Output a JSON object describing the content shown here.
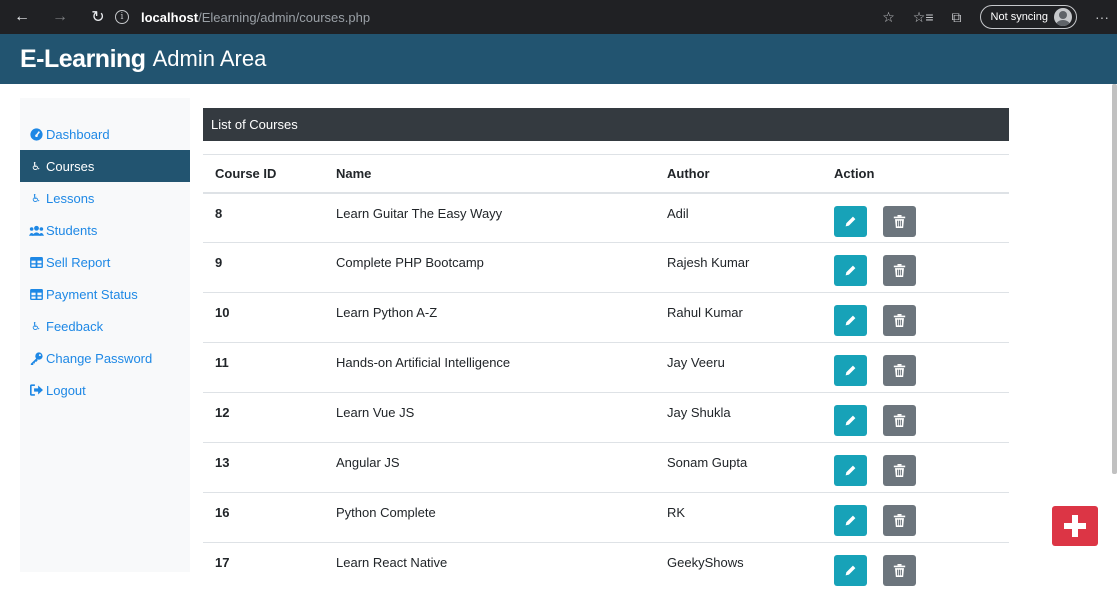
{
  "browser": {
    "url_host": "localhost",
    "url_path": "/Elearning/admin/courses.php",
    "sync_label": "Not syncing",
    "icons": [
      "back-arrow",
      "forward-arrow",
      "refresh",
      "info",
      "star",
      "favorites",
      "collections",
      "profile",
      "more"
    ]
  },
  "header": {
    "brand": "E-Learning",
    "sub": "Admin Area"
  },
  "sidebar": {
    "items": [
      {
        "label": "Dashboard",
        "icon": "tachometer"
      },
      {
        "label": "Courses",
        "icon": "accessible"
      },
      {
        "label": "Lessons",
        "icon": "accessible"
      },
      {
        "label": "Students",
        "icon": "users"
      },
      {
        "label": "Sell Report",
        "icon": "table"
      },
      {
        "label": "Payment Status",
        "icon": "table"
      },
      {
        "label": "Feedback",
        "icon": "accessible"
      },
      {
        "label": "Change Password",
        "icon": "key"
      },
      {
        "label": "Logout",
        "icon": "sign-out"
      }
    ],
    "active": "Courses"
  },
  "main": {
    "panel_title": "List of Courses",
    "columns": [
      "Course ID",
      "Name",
      "Author",
      "Action"
    ],
    "rows": [
      {
        "id": "8",
        "name": "Learn Guitar The Easy Wayy",
        "author": "Adil"
      },
      {
        "id": "9",
        "name": "Complete PHP Bootcamp",
        "author": "Rajesh Kumar"
      },
      {
        "id": "10",
        "name": "Learn Python A-Z",
        "author": "Rahul Kumar"
      },
      {
        "id": "11",
        "name": "Hands-on Artificial Intelligence",
        "author": "Jay Veeru"
      },
      {
        "id": "12",
        "name": "Learn Vue JS",
        "author": "Jay Shukla"
      },
      {
        "id": "13",
        "name": "Angular JS",
        "author": "Sonam Gupta"
      },
      {
        "id": "16",
        "name": "Python Complete",
        "author": "RK"
      },
      {
        "id": "17",
        "name": "Learn React Native",
        "author": "GeekyShows"
      }
    ]
  },
  "colors": {
    "brand": "#225470",
    "edit": "#17a2b8",
    "delete": "#6c757d",
    "add": "#dc3545",
    "link": "#1e88e5"
  }
}
